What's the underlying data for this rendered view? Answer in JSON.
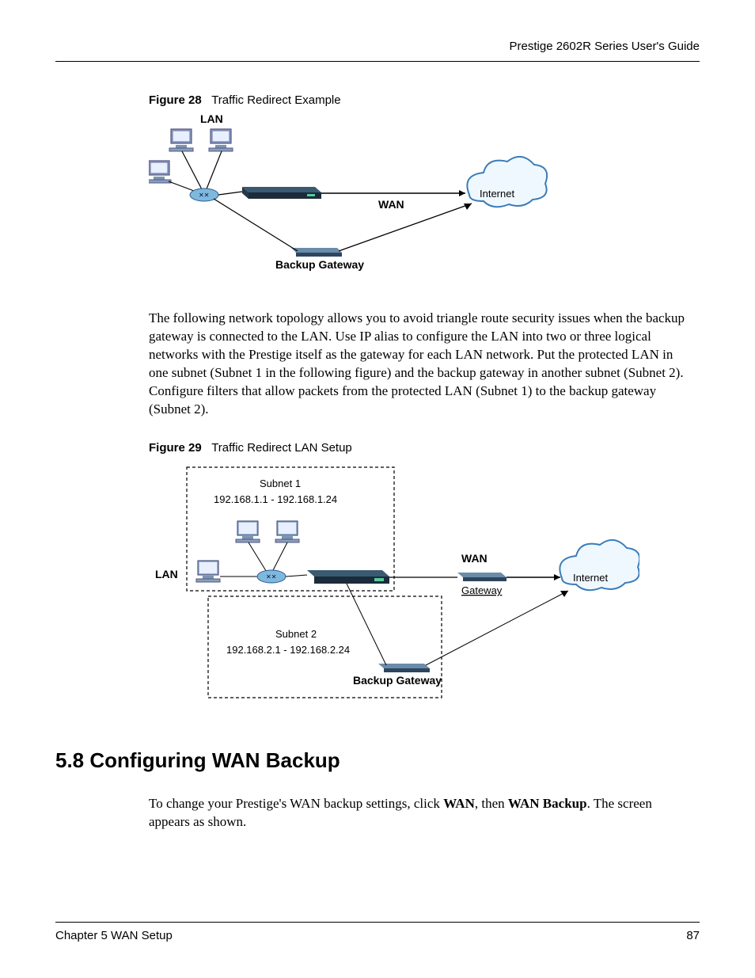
{
  "header": {
    "guide_title": "Prestige 2602R Series User's Guide"
  },
  "figure28": {
    "caption_prefix": "Figure 28",
    "caption_text": "Traffic Redirect Example",
    "labels": {
      "lan": "LAN",
      "wan": "WAN",
      "internet": "Internet",
      "backup_gateway": "Backup Gateway"
    }
  },
  "paragraph1": "The following network topology allows you to avoid triangle route security issues when the backup gateway is connected to the LAN. Use IP alias to configure the LAN into two or three logical networks with the Prestige itself as the gateway for each LAN network. Put the protected LAN in one subnet (Subnet 1 in the following figure) and the backup gateway in another subnet (Subnet 2). Configure filters that allow packets from the protected LAN (Subnet 1) to the backup gateway (Subnet 2).",
  "figure29": {
    "caption_prefix": "Figure 29",
    "caption_text": "Traffic Redirect LAN Setup",
    "labels": {
      "subnet1_title": "Subnet 1",
      "subnet1_range": "192.168.1.1 - 192.168.1.24",
      "subnet2_title": "Subnet 2",
      "subnet2_range": "192.168.2.1 - 192.168.2.24",
      "lan": "LAN",
      "wan": "WAN",
      "gateway": "Gateway",
      "internet": "Internet",
      "backup_gateway": "Backup Gateway"
    }
  },
  "section58": {
    "heading": "5.8  Configuring WAN Backup",
    "para_pre": "To change your Prestige's WAN backup settings, click ",
    "bold1": "WAN",
    "mid": ", then ",
    "bold2": "WAN Backup",
    "para_post": ". The screen appears as shown."
  },
  "footer": {
    "chapter": "Chapter 5 WAN Setup",
    "page": "87"
  }
}
